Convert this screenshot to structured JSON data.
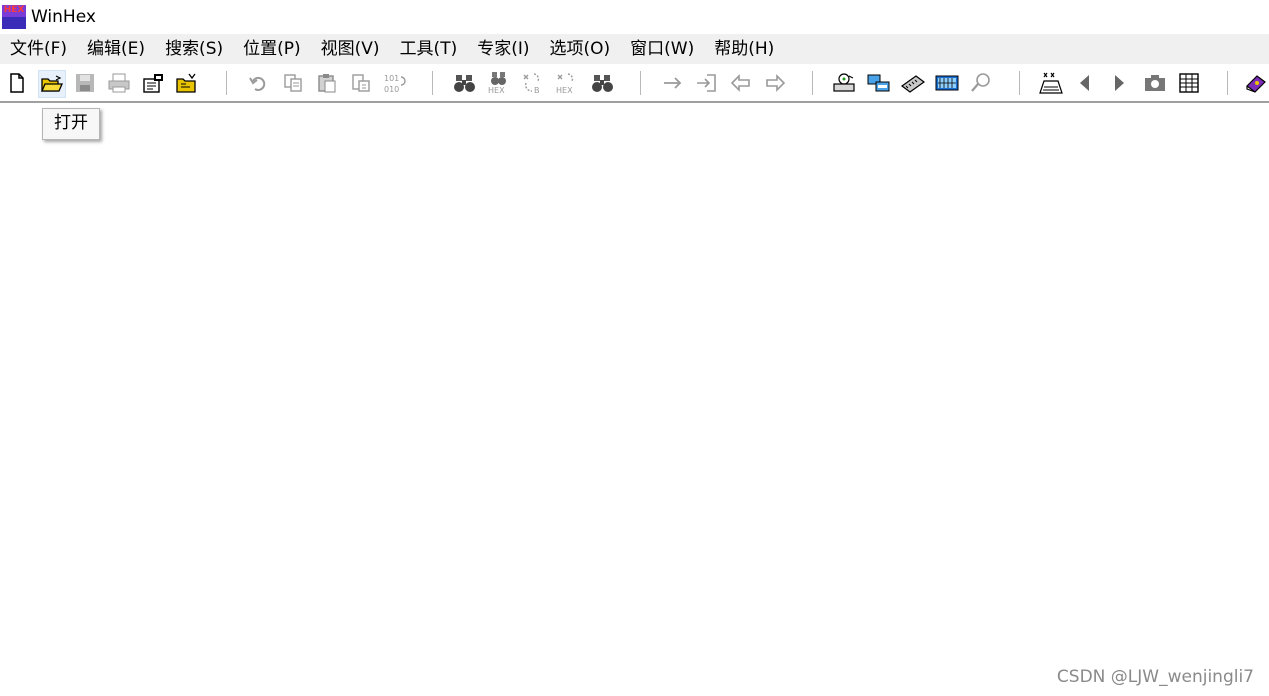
{
  "window": {
    "title": "WinHex",
    "icon": "winhex-app-icon",
    "icon_text": "HEX"
  },
  "menubar": {
    "items": [
      {
        "label": "文件(F)"
      },
      {
        "label": "编辑(E)"
      },
      {
        "label": "搜索(S)"
      },
      {
        "label": "位置(P)"
      },
      {
        "label": "视图(V)"
      },
      {
        "label": "工具(T)"
      },
      {
        "label": "专家(I)"
      },
      {
        "label": "选项(O)"
      },
      {
        "label": "窗口(W)"
      },
      {
        "label": "帮助(H)"
      }
    ]
  },
  "toolbar": {
    "groups": [
      [
        "new-file-icon",
        "open-folder-icon",
        "save-icon",
        "print-icon",
        "properties-icon",
        "open-directory-icon"
      ],
      [
        "undo-icon",
        "copy-icon",
        "paste-icon",
        "paste-special-icon",
        "write-binary-icon"
      ],
      [
        "find-text-icon",
        "find-hex-icon",
        "replace-text-icon",
        "replace-hex-icon",
        "find-next-icon"
      ],
      [
        "goto-offset-icon",
        "goto-sector-icon",
        "back-icon",
        "forward-icon"
      ],
      [
        "open-disk-icon",
        "clone-disk-icon",
        "open-ram-icon",
        "calculator-icon",
        "inspect-icon"
      ],
      [
        "analyze-icon",
        "prev-icon",
        "next-icon",
        "snapshot-icon",
        "table-icon"
      ],
      [
        "help-book-icon"
      ]
    ]
  },
  "tooltip": {
    "text": "打开"
  },
  "watermark": {
    "text": "CSDN @LJW_wenjingli7"
  },
  "colors": {
    "menubar_bg": "#f0f0f0",
    "toolbar_border": "#a0a0a0",
    "tooltip_bg": "#f7f7f7",
    "icon_yellow": "#e8c400"
  }
}
